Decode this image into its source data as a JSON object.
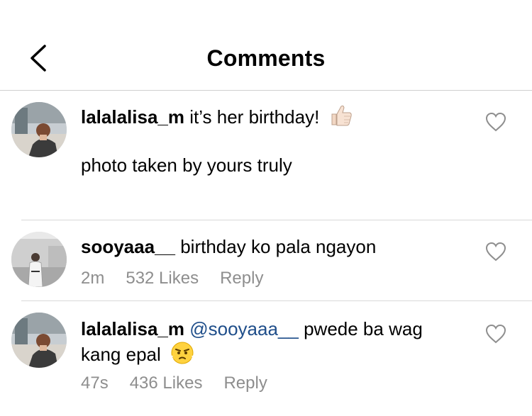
{
  "header": {
    "title": "Comments"
  },
  "caption": {
    "username": "lalalalisa_m",
    "text": "it’s her birthday!",
    "emoji": "thumbs-up-emoji",
    "second_line": "photo taken by yours truly"
  },
  "comments": [
    {
      "username": "sooyaaa__",
      "text": "birthday ko pala ngayon",
      "time": "2m",
      "likes": "532 Likes",
      "reply": "Reply"
    },
    {
      "username": "lalalalisa_m",
      "mention": "@sooyaaa__",
      "text_part1": "pwede ba wag",
      "text_part2": "kang epal",
      "emoji": "angry-face-emoji",
      "time": "47s",
      "likes": "436 Likes",
      "reply": "Reply"
    }
  ],
  "colors": {
    "accent_link": "#1f4e8a",
    "meta_gray": "#8e8e8e",
    "divider": "#d8d8d8"
  }
}
